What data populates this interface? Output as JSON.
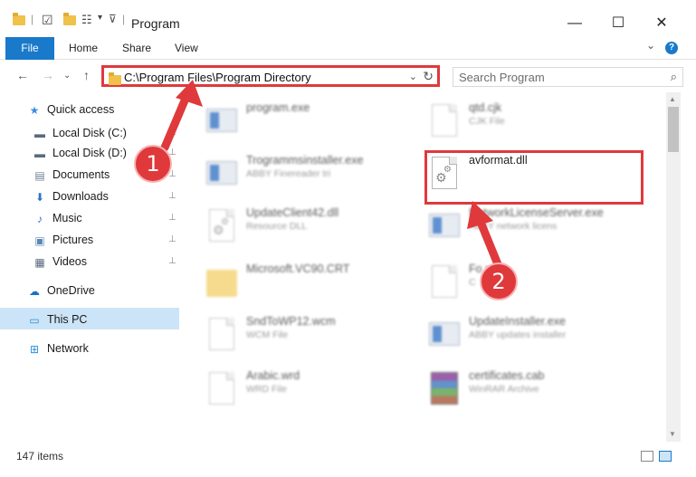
{
  "window": {
    "title": "Program",
    "min_glyph": "—",
    "max_glyph": "☐",
    "close_glyph": "✕"
  },
  "ribbon": {
    "tabs": [
      "File",
      "Home",
      "Share",
      "View"
    ],
    "expand_glyph": "⌄",
    "help_glyph": "?"
  },
  "nav": {
    "back_glyph": "←",
    "forward_glyph": "→",
    "history_glyph": "⌄",
    "up_glyph": "↑",
    "address": "C:\\Program Files\\Program Directory",
    "address_drop_glyph": "⌄",
    "refresh_glyph": "↻",
    "search_placeholder": "Search Program",
    "search_glyph": "⌕"
  },
  "sidebar": {
    "items": [
      {
        "label": "Quick access",
        "icon": "star-icon",
        "glyph": "★",
        "color": "#3a8de0",
        "pinned": false
      },
      {
        "label": "Local Disk (C:)",
        "icon": "drive-icon",
        "glyph": "▬",
        "color": "#5b6b7d",
        "pinned": true
      },
      {
        "label": "Local Disk (D:)",
        "icon": "drive-icon",
        "glyph": "▬",
        "color": "#5b6b7d",
        "pinned": true
      },
      {
        "label": "Documents",
        "icon": "documents-icon",
        "glyph": "▤",
        "color": "#6d7f93",
        "pinned": true
      },
      {
        "label": "Downloads",
        "icon": "downloads-icon",
        "glyph": "⬇",
        "color": "#2a73c7",
        "pinned": true
      },
      {
        "label": "Music",
        "icon": "music-icon",
        "glyph": "♪",
        "color": "#2a73c7",
        "pinned": true
      },
      {
        "label": "Pictures",
        "icon": "pictures-icon",
        "glyph": "▣",
        "color": "#5b87b5",
        "pinned": true
      },
      {
        "label": "Videos",
        "icon": "videos-icon",
        "glyph": "▦",
        "color": "#5b6b7d",
        "pinned": true
      },
      {
        "label": "OneDrive",
        "icon": "cloud-icon",
        "glyph": "☁",
        "color": "#1f6fc5",
        "pinned": false
      },
      {
        "label": "This PC",
        "icon": "computer-icon",
        "glyph": "▭",
        "color": "#2a8fd6",
        "pinned": false
      },
      {
        "label": "Network",
        "icon": "network-icon",
        "glyph": "⊞",
        "color": "#2a8fd6",
        "pinned": false
      }
    ],
    "pin_glyph": "📌"
  },
  "files": [
    {
      "name": "program.exe",
      "sub": "",
      "icon": "exe"
    },
    {
      "name": "qtd.cjk",
      "sub": "CJK File",
      "icon": "doc"
    },
    {
      "name": "Trogrammsinstaller.exe",
      "sub": "ABBY Finereader tri",
      "icon": "exe"
    },
    {
      "name": "avformat.dll",
      "sub": "",
      "icon": "dll"
    },
    {
      "name": "UpdateClient42.dll",
      "sub": "Resource DLL",
      "icon": "dll"
    },
    {
      "name": "NetworkLicenseServer.exe",
      "sub": "ABBY network licens",
      "icon": "exe"
    },
    {
      "name": "Microsoft.VC90.CRT",
      "sub": "",
      "icon": "folder"
    },
    {
      "name": "Fo  n.cjk",
      "sub": "C",
      "icon": "doc"
    },
    {
      "name": "SndToWP12.wcm",
      "sub": "WCM File",
      "icon": "doc"
    },
    {
      "name": "UpdateInstaller.exe",
      "sub": "ABBY updates installer",
      "icon": "exe"
    },
    {
      "name": "Arabic.wrd",
      "sub": "WRD File",
      "icon": "doc"
    },
    {
      "name": "certificates.cab",
      "sub": "WinRAR Archive",
      "icon": "cab"
    }
  ],
  "annotations": {
    "step1": "1",
    "step2": "2",
    "color": "#e0393c"
  },
  "status": {
    "item_count": "147 items"
  }
}
